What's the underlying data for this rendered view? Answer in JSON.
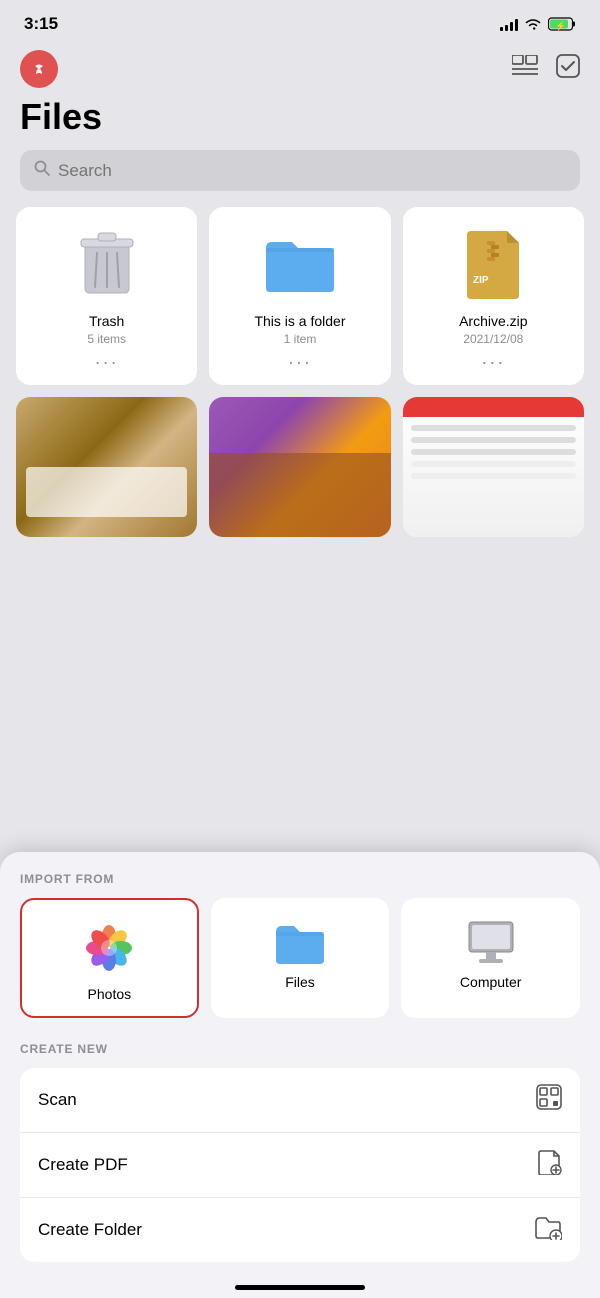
{
  "statusBar": {
    "time": "3:15",
    "signalBars": [
      4,
      6,
      8,
      10,
      12
    ],
    "battery": "charging"
  },
  "header": {
    "viewToggleLabel": "view-toggle",
    "checkboxLabel": "select"
  },
  "pageTitle": "Files",
  "search": {
    "placeholder": "Search"
  },
  "fileGrid": {
    "items": [
      {
        "name": "Trash",
        "meta": "5 items",
        "type": "trash"
      },
      {
        "name": "This is a folder",
        "meta": "1 item",
        "type": "folder"
      },
      {
        "name": "Archive.zip",
        "meta": "2021/12/08",
        "type": "zip"
      }
    ]
  },
  "bottomSheet": {
    "importLabel": "IMPORT FROM",
    "importItems": [
      {
        "id": "photos",
        "label": "Photos",
        "selected": true
      },
      {
        "id": "files",
        "label": "Files",
        "selected": false
      },
      {
        "id": "computer",
        "label": "Computer",
        "selected": false
      }
    ],
    "createLabel": "CREATE NEW",
    "createItems": [
      {
        "id": "scan",
        "label": "Scan"
      },
      {
        "id": "create-pdf",
        "label": "Create PDF"
      },
      {
        "id": "create-folder",
        "label": "Create Folder"
      }
    ]
  }
}
